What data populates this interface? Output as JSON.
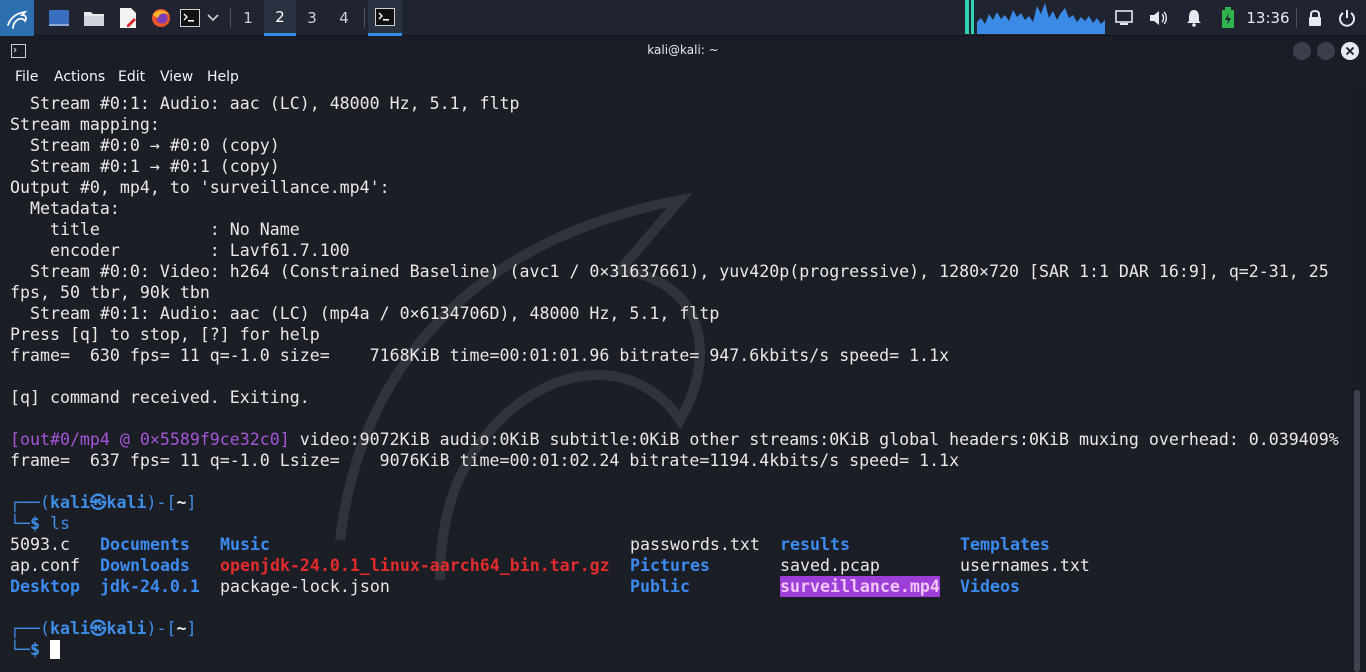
{
  "panel": {
    "workspaces": [
      "1",
      "2",
      "3",
      "4"
    ],
    "active_workspace": "2",
    "time": "13:36",
    "accent": "#2f8fe6"
  },
  "window": {
    "title": "kali@kali: ~"
  },
  "menu": [
    "File",
    "Actions",
    "Edit",
    "View",
    "Help"
  ],
  "terminal": {
    "lines": [
      "  Stream #0:1: Audio: aac (LC), 48000 Hz, 5.1, fltp",
      "Stream mapping:",
      "  Stream #0:0 → #0:0 (copy)",
      "  Stream #0:1 → #0:1 (copy)",
      "Output #0, mp4, to 'surveillance.mp4':",
      "  Metadata:",
      "    title           : No Name",
      "    encoder         : Lavf61.7.100",
      "  Stream #0:0: Video: h264 (Constrained Baseline) (avc1 / 0×31637661), yuv420p(progressive), 1280×720 [SAR 1:1 DAR 16:9], q=2-31, 25",
      "fps, 50 tbr, 90k tbn",
      "  Stream #0:1: Audio: aac (LC) (mp4a / 0×6134706D), 48000 Hz, 5.1, fltp",
      "Press [q] to stop, [?] for help",
      "frame=  630 fps= 11 q=-1.0 size=    7168KiB time=00:01:01.96 bitrate= 947.6kbits/s speed= 1.1x",
      "",
      "[q] command received. Exiting."
    ],
    "muxer_tag": "[out#0/mp4 @ 0×5589f9ce32c0]",
    "muxer_rest": " video:9072KiB audio:0KiB subtitle:0KiB other streams:0KiB global headers:0KiB muxing overhead: 0.039409%",
    "final_frame": "frame=  637 fps= 11 q=-1.0 Lsize=    9076KiB time=00:01:02.24 bitrate=1194.4kbits/s speed= 1.1x",
    "prompt_top": "┌──(",
    "prompt_user": "kali㉿kali",
    "prompt_mid": ")-[",
    "prompt_dir": "~",
    "prompt_end": "]",
    "prompt_bottom": "└─",
    "prompt_symbol": "$",
    "command": " ls",
    "ls": [
      [
        "5093.c",
        "ap.conf",
        "Desktop"
      ],
      [
        "Documents",
        "Downloads",
        "jdk-24.0.1"
      ],
      [
        "Music",
        "openjdk-24.0.1_linux-aarch64_bin.tar.gz",
        "package-lock.json"
      ],
      [
        "passwords.txt",
        "Pictures",
        "Public"
      ],
      [
        "results",
        "saved.pcap",
        "surveillance.mp4"
      ],
      [
        "Templates",
        "usernames.txt",
        "Videos"
      ]
    ]
  }
}
